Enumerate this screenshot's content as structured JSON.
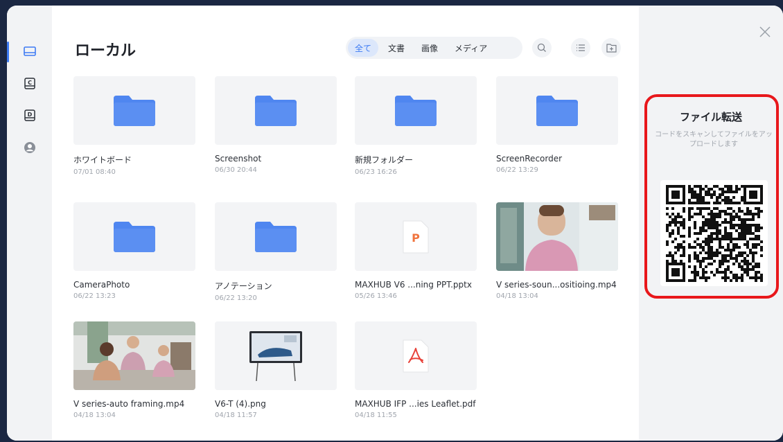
{
  "sidebar": {
    "items": [
      {
        "name": "local",
        "icon": "monitor-icon",
        "active": true
      },
      {
        "name": "drive-c",
        "icon": "drive-c-icon",
        "label": "C"
      },
      {
        "name": "drive-d",
        "icon": "drive-d-icon",
        "label": "D"
      },
      {
        "name": "account",
        "icon": "user-icon"
      }
    ]
  },
  "header": {
    "title": "ローカル",
    "filters": [
      "全て",
      "文書",
      "画像",
      "メディア"
    ],
    "active_filter": 0,
    "icons": [
      "search-icon",
      "list-view-icon",
      "new-folder-icon"
    ]
  },
  "files": [
    {
      "name": "ホワイトボード",
      "date": "07/01 08:40",
      "type": "folder"
    },
    {
      "name": "Screenshot",
      "date": "06/30 20:44",
      "type": "folder"
    },
    {
      "name": "新規フォルダー",
      "date": "06/23 16:26",
      "type": "folder"
    },
    {
      "name": "ScreenRecorder",
      "date": "06/22 13:29",
      "type": "folder"
    },
    {
      "name": "CameraPhoto",
      "date": "06/22 13:23",
      "type": "folder"
    },
    {
      "name": "アノテーション",
      "date": "06/22 13:20",
      "type": "folder"
    },
    {
      "name": "MAXHUB V6 ...ning PPT.pptx",
      "date": "05/26 13:46",
      "type": "pptx",
      "badge": "P"
    },
    {
      "name": "V series-soun...ositioing.mp4",
      "date": "04/18 13:04",
      "type": "video"
    },
    {
      "name": "V series-auto framing.mp4",
      "date": "04/18 13:04",
      "type": "video"
    },
    {
      "name": "V6-T (4).png",
      "date": "04/18 11:57",
      "type": "image"
    },
    {
      "name": "MAXHUB IFP ...ies Leaflet.pdf",
      "date": "04/18 11:55",
      "type": "pdf"
    }
  ],
  "transfer": {
    "title": "ファイル転送",
    "description": "コードをスキャンしてファイルをアップロードします",
    "close_icon": "close-icon",
    "highlight_color": "#e8171b"
  },
  "colors": {
    "accent": "#3d7bf3",
    "folder": "#4f86f0",
    "pptx": "#f0743e",
    "pdf": "#e8423a"
  }
}
